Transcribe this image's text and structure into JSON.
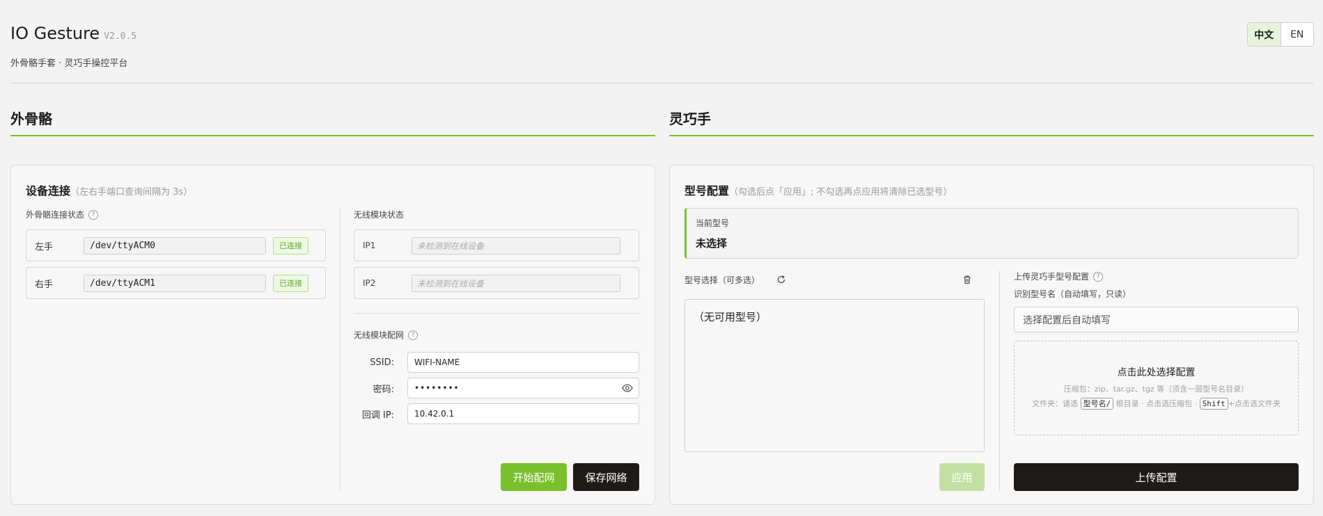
{
  "header": {
    "title": "IO Gesture",
    "version": "V2.0.5",
    "subtitle": "外骨骼手套 · 灵巧手操控平台",
    "lang_zh": "中文",
    "lang_en": "EN"
  },
  "exo": {
    "section_title": "外骨骼",
    "card_title": "设备连接",
    "card_hint": "（左右手端口查询间隔为 3s）",
    "status_label": "外骨骼连接状态",
    "devices": [
      {
        "label": "左手",
        "port": "/dev/ttyACM0",
        "status": "已连接"
      },
      {
        "label": "右手",
        "port": "/dev/ttyACM1",
        "status": "已连接"
      }
    ],
    "wireless_status_label": "无线模块状态",
    "ips": [
      {
        "label": "IP1",
        "placeholder": "未检测到在线设备"
      },
      {
        "label": "IP2",
        "placeholder": "未检测到在线设备"
      }
    ],
    "wifi_config_label": "无线模块配网",
    "ssid_label": "SSID:",
    "ssid_value": "WIFI-NAME",
    "password_label": "密码:",
    "password_value": "••••••••",
    "callback_label": "回调 IP:",
    "callback_value": "10.42.0.1",
    "start_btn": "开始配网",
    "save_btn": "保存网络"
  },
  "hand": {
    "section_title": "灵巧手",
    "card_title": "型号配置",
    "card_hint": "（勾选后点「应用」; 不勾选再点应用将清除已选型号）",
    "current_label": "当前型号",
    "current_value": "未选择",
    "select_label": "型号选择（可多选）",
    "empty_list": "（无可用型号）",
    "apply_btn": "应用",
    "upload_label": "上传灵巧手型号配置",
    "recognized_label": "识别型号名（自动填写，只读）",
    "recognized_placeholder": "选择配置后自动填写",
    "dropzone_title": "点击此处选择配置",
    "dropzone_line1": "压缩包：zip、tar.gz、tgz 等（须含一层型号名目录）",
    "dz_prefix": "文件夹：请选",
    "dz_kbd1": "型号名/",
    "dz_mid": "根目录 · 点击选压缩包 ·",
    "dz_kbd2": "Shift",
    "dz_suffix": "+点击选文件夹",
    "upload_btn": "上传配置"
  },
  "colors": {
    "accent": "#7ac02d",
    "dark": "#1e1b18",
    "success_text": "#5ea82a"
  }
}
